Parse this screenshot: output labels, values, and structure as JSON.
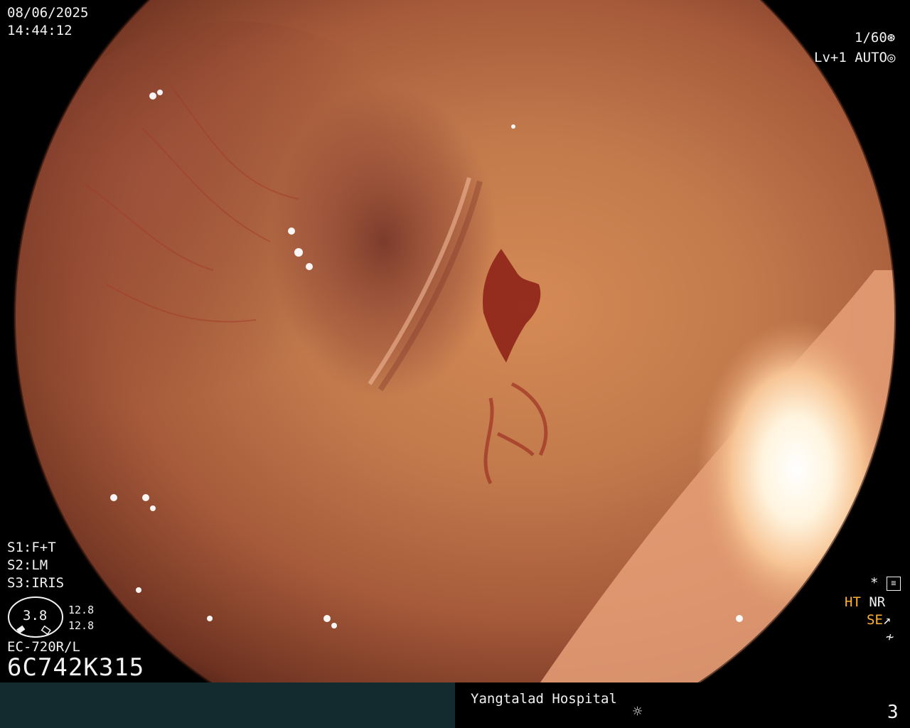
{
  "overlay": {
    "date": "08/06/2025",
    "time": "14:44:12",
    "shutter": "1/60",
    "shutter_icon": "shutter-icon",
    "level": "Lv+1",
    "mode": "AUTO",
    "mode_icon": "auto-iris-icon",
    "settings": [
      "S1:F+T",
      "S2:LM",
      "S3:IRIS"
    ],
    "gauge_value": "3.8",
    "gauge_readings": [
      "12.8",
      "12.8"
    ],
    "scope_model": "EC-720R/L",
    "serial": "6C742K315",
    "status": {
      "star_icon": "star-icon",
      "settings_icon": "settings-sliders-icon",
      "ht": "HT",
      "nr": "NR",
      "se": "SE",
      "se_icon": "curve-icon",
      "freeze_icon": "freeze-icon"
    }
  },
  "bottom_bar": {
    "hospital": "Yangtalad Hospital",
    "light_icon": "sun-icon",
    "page_number": "3"
  },
  "colors": {
    "overlay_text": "#f2f2f2",
    "status_orange": "#ffb13b",
    "bar_left_bg": "#132a2e",
    "bar_right_bg": "#000000"
  }
}
